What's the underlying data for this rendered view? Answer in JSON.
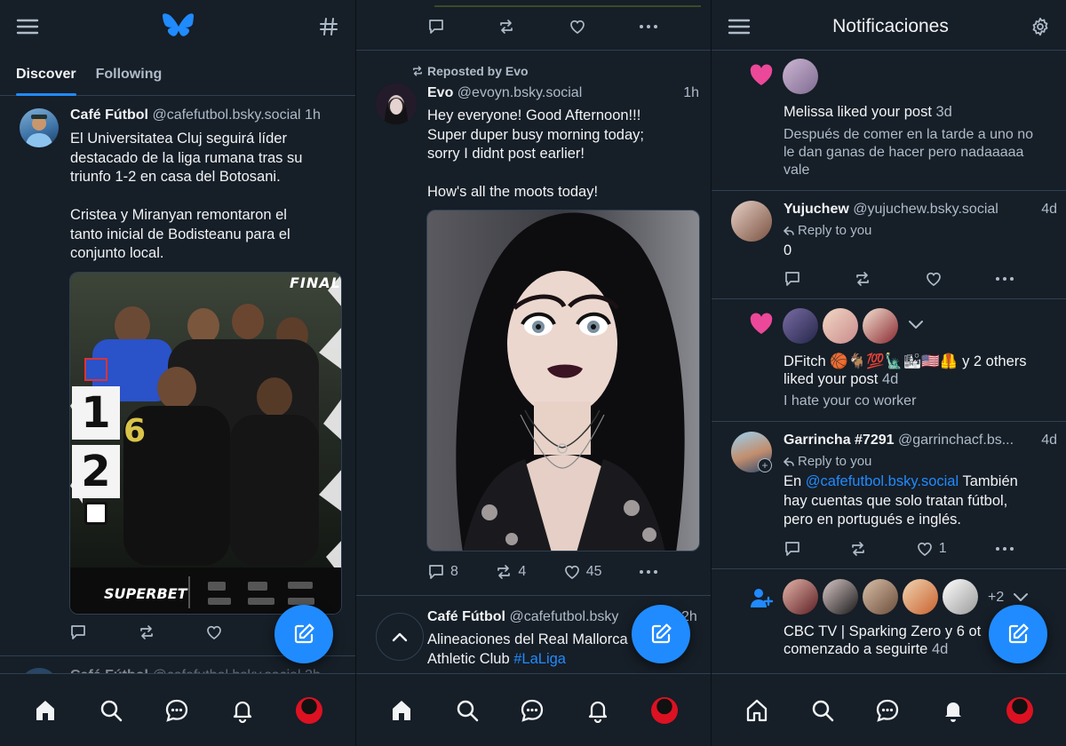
{
  "colors": {
    "bg": "#161e27",
    "accent": "#208bfe",
    "like": "#ec4899",
    "muted": "#aebbc9",
    "divider": "#2e4052"
  },
  "panel1": {
    "tabs": [
      {
        "label": "Discover",
        "active": true
      },
      {
        "label": "Following",
        "active": false
      }
    ],
    "post": {
      "name": "Café Fútbol",
      "handle": "@cafefutbol.bsky.social",
      "time": "1h",
      "lines": [
        "El Universitatea Cluj seguirá líder",
        "destacado de la liga rumana tras su",
        "triunfo 1-2 en casa del Botosani.",
        "",
        "Cristea y Miranyan remontaron el",
        "tanto inicial de Bodisteanu para el",
        "conjunto local."
      ],
      "media": {
        "badge": "FINAL",
        "score_home": "1",
        "score_away": "2",
        "sponsor": "SUPERBET"
      }
    },
    "next_post_partial": {
      "name": "Café Fútbol",
      "handle": "@cafefutbol.bsky.social",
      "time": "2h"
    }
  },
  "panel2": {
    "repost_label": "Reposted by Evo",
    "post": {
      "name": "Evo",
      "handle": "@evoyn.bsky.social",
      "time": "1h",
      "lines": [
        "Hey everyone! Good Afternoon!!!",
        "Super duper busy morning today;",
        "sorry I didnt post earlier!",
        "",
        "How's all the moots today!"
      ],
      "replies": "8",
      "reposts": "4",
      "likes": "45"
    },
    "next_post": {
      "name": "Café Fútbol",
      "handle": "@cafefutbol.bsky",
      "time": "2h",
      "line1": "Alineaciones del Real Mallorca",
      "line2_prefix": "Athletic Club",
      "hashtag": "#LaLiga"
    }
  },
  "panel3": {
    "title": "Notificaciones",
    "n1": {
      "text": "Melissa liked your post",
      "time": "3d",
      "preview": [
        "Después de comer en la tarde a uno no",
        "le dan ganas de hacer pero nadaaaaa",
        "vale"
      ]
    },
    "n2": {
      "name": "Yujuchew",
      "handle": "@yujuchew.bsky.social",
      "time": "4d",
      "reply_label": "Reply to you",
      "body": "0"
    },
    "n3": {
      "line1_name": "DFitch",
      "line1_emoji": "🏀🐐💯🗽🏙🇺🇸🦺",
      "line1_suffix": "y 2 others",
      "line2": "liked your post",
      "time": "4d",
      "preview": "I hate your co worker"
    },
    "n4": {
      "name": "Garrincha #7291",
      "handle": "@garrinchacf.bs...",
      "time": "4d",
      "reply_label": "Reply to you",
      "body_prefix": "En",
      "mention": "@cafefutbol.bsky.social",
      "body_rest": "También",
      "line2": "hay cuentas que solo tratan fútbol,",
      "line3": "pero en portugués e inglés.",
      "likes": "1"
    },
    "n5": {
      "extra": "+2",
      "line1": "CBC TV | Sparking Zero y 6 ot",
      "line2": "comenzado a seguirte",
      "time": "4d"
    }
  }
}
